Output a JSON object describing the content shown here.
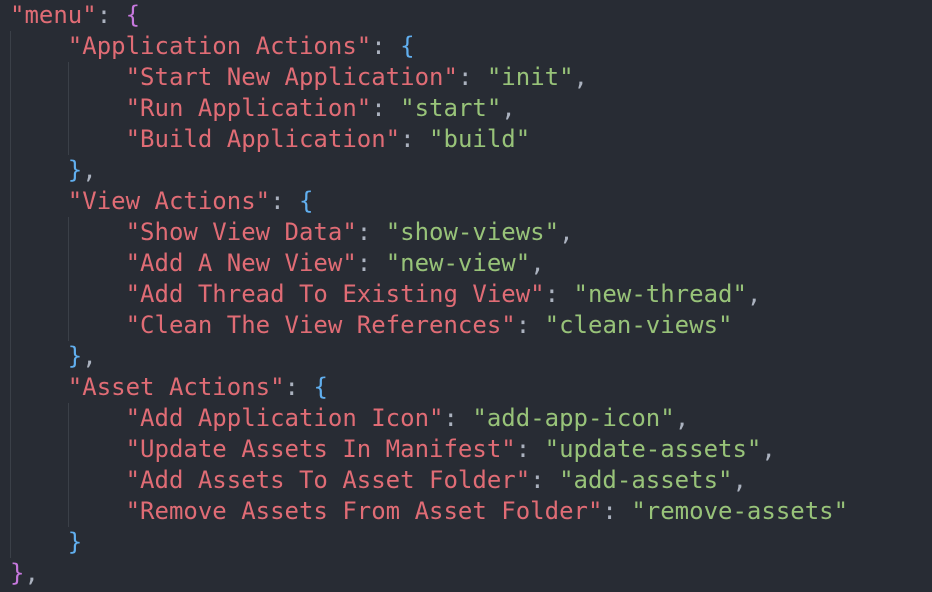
{
  "editor": {
    "root_key": "\"menu\"",
    "sections": [
      {
        "key": "\"Application Actions\"",
        "entries": [
          {
            "key": "\"Start New Application\"",
            "value": "\"init\""
          },
          {
            "key": "\"Run Application\"",
            "value": "\"start\""
          },
          {
            "key": "\"Build Application\"",
            "value": "\"build\""
          }
        ]
      },
      {
        "key": "\"View Actions\"",
        "entries": [
          {
            "key": "\"Show View Data\"",
            "value": "\"show-views\""
          },
          {
            "key": "\"Add A New View\"",
            "value": "\"new-view\""
          },
          {
            "key": "\"Add Thread To Existing View\"",
            "value": "\"new-thread\""
          },
          {
            "key": "\"Clean The View References\"",
            "value": "\"clean-views\""
          }
        ]
      },
      {
        "key": "\"Asset Actions\"",
        "entries": [
          {
            "key": "\"Add Application Icon\"",
            "value": "\"add-app-icon\""
          },
          {
            "key": "\"Update Assets In Manifest\"",
            "value": "\"update-assets\""
          },
          {
            "key": "\"Add Assets To Asset Folder\"",
            "value": "\"add-assets\""
          },
          {
            "key": "\"Remove Assets From Asset Folder\"",
            "value": "\"remove-assets\""
          }
        ]
      }
    ],
    "colors": {
      "background": "#282c34",
      "key": "#e06c75",
      "string": "#98c379",
      "punctuation": "#abb2bf",
      "outer_brace": "#c678dd",
      "inner_brace": "#61afef"
    }
  }
}
